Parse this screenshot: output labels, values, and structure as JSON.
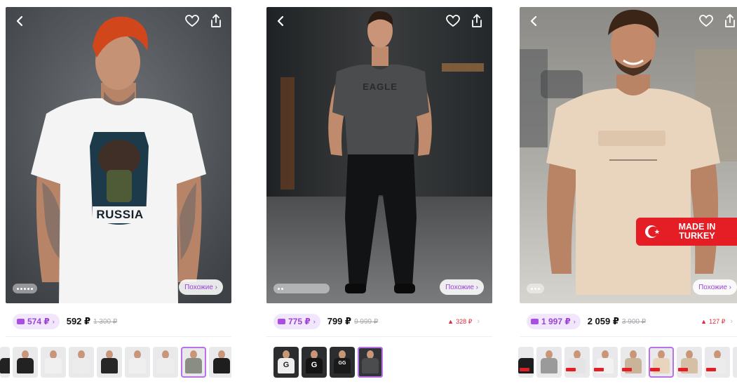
{
  "colors": {
    "accent": "#9b43d6",
    "accent_bg": "#f1e6fb",
    "rating_red": "#e51e25",
    "selected_outline": "#b872ea"
  },
  "icons": {
    "back": "chevron-left-icon",
    "favorite": "heart-icon",
    "share": "share-icon",
    "wallet": "wallet-card-icon",
    "rating": "triangle-up-icon"
  },
  "cards": [
    {
      "similar_label": "Похожие ›",
      "print_text": "RUSSIA",
      "wallet_price": "574 ₽",
      "price": "592 ₽",
      "old_price": "1 300 ₽",
      "rating_count": "",
      "thumb_count": 9,
      "selected_thumb": 6
    },
    {
      "similar_label": "Похожие ›",
      "print_text": "EAGLE",
      "wallet_price": "775 ₽",
      "price": "799 ₽",
      "old_price": "9 999 ₽",
      "rating_count": "328 ₽",
      "thumb_count": 4,
      "selected_thumb": 3
    },
    {
      "similar_label": "Похожие ›",
      "badge_line1": "MADE IN",
      "badge_line2": "TURKEY",
      "wallet_price": "1 997 ₽",
      "price": "2 059 ₽",
      "old_price": "3 900 ₽",
      "rating_count": "127 ₽",
      "thumb_count": 8,
      "selected_thumb": 5
    }
  ]
}
